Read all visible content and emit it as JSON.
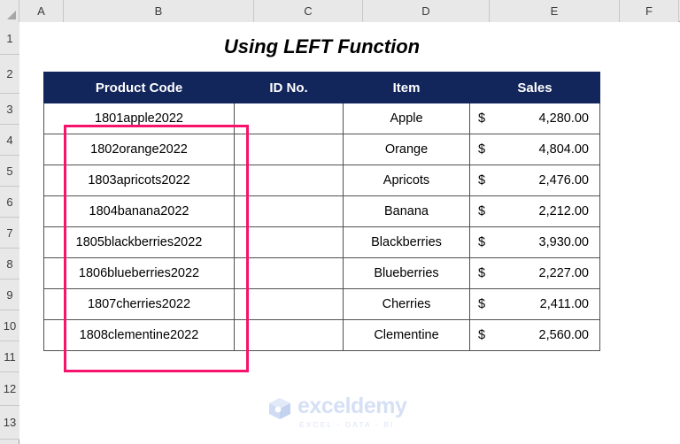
{
  "spreadsheet": {
    "column_headers": [
      "A",
      "B",
      "C",
      "D",
      "E",
      "F"
    ],
    "row_headers": [
      "1",
      "2",
      "3",
      "4",
      "5",
      "6",
      "7",
      "8",
      "9",
      "10",
      "11",
      "12",
      "13"
    ],
    "title": "Using LEFT Function"
  },
  "table": {
    "headers": [
      "Product Code",
      "ID No.",
      "Item",
      "Sales"
    ],
    "rows": [
      {
        "product_code": "1801apple2022",
        "id_no": "",
        "item": "Apple",
        "currency": "$",
        "sales": "4,280.00"
      },
      {
        "product_code": "1802orange2022",
        "id_no": "",
        "item": "Orange",
        "currency": "$",
        "sales": "4,804.00"
      },
      {
        "product_code": "1803apricots2022",
        "id_no": "",
        "item": "Apricots",
        "currency": "$",
        "sales": "2,476.00"
      },
      {
        "product_code": "1804banana2022",
        "id_no": "",
        "item": "Banana",
        "currency": "$",
        "sales": "2,212.00"
      },
      {
        "product_code": "1805blackberries2022",
        "id_no": "",
        "item": "Blackberries",
        "currency": "$",
        "sales": "3,930.00"
      },
      {
        "product_code": "1806blueberries2022",
        "id_no": "",
        "item": "Blueberries",
        "currency": "$",
        "sales": "2,227.00"
      },
      {
        "product_code": "1807cherries2022",
        "id_no": "",
        "item": "Cherries",
        "currency": "$",
        "sales": "2,411.00"
      },
      {
        "product_code": "1808clementine2022",
        "id_no": "",
        "item": "Clementine",
        "currency": "$",
        "sales": "2,560.00"
      }
    ]
  },
  "watermark": {
    "brand": "exceldemy",
    "tagline": "EXCEL - DATA - BI"
  },
  "colors": {
    "header_navy": "#12265c",
    "selection_pink": "#f7136c",
    "grid_border": "#505050",
    "header_strip": "#e8e8e8",
    "watermark_blue": "#d6e0f5"
  }
}
